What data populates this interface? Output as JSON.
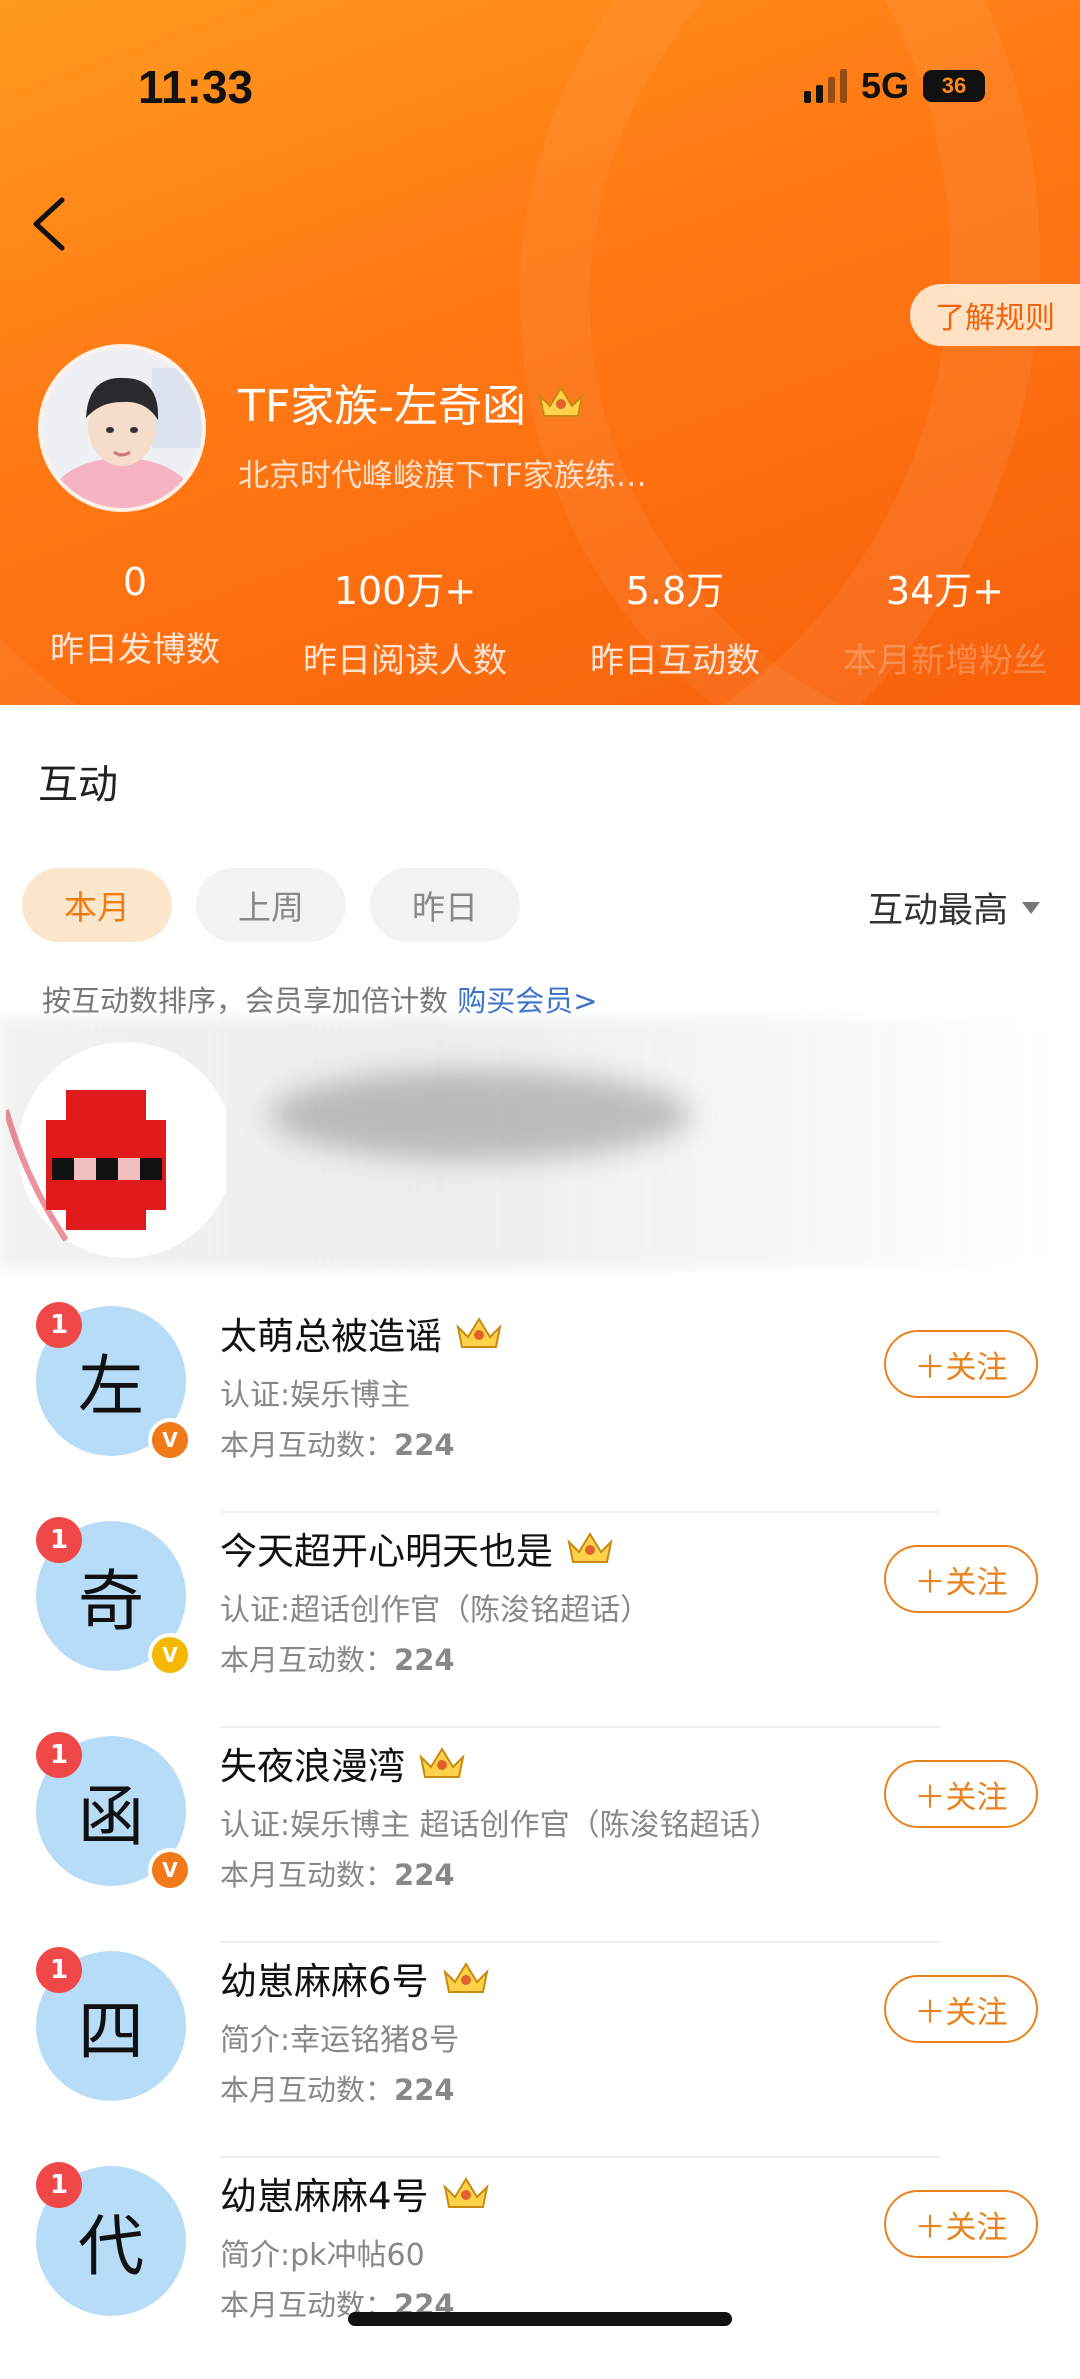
{
  "status": {
    "time": "11:33",
    "network": "5G",
    "battery": "36"
  },
  "header": {
    "rules_label": "了解规则",
    "profile_name": "TF家族-左奇函",
    "profile_desc": "北京时代峰峻旗下TF家族练…",
    "crown_icon": "crown-icon",
    "stats": [
      {
        "value": "0",
        "label": "昨日发博数"
      },
      {
        "value": "100万+",
        "label": "昨日阅读人数"
      },
      {
        "value": "5.8万",
        "label": "昨日互动数"
      },
      {
        "value": "34万+",
        "label": "本月新增粉丝"
      }
    ]
  },
  "section": {
    "title": "互动"
  },
  "tabs": [
    {
      "label": "本月",
      "active": true
    },
    {
      "label": "上周",
      "active": false
    },
    {
      "label": "昨日",
      "active": false
    }
  ],
  "sort": {
    "label": "互动最高"
  },
  "note": {
    "text": "按互动数排序，会员享加倍计数 ",
    "link": "购买会员>"
  },
  "fans": [
    {
      "rank": "1",
      "avatar_char": "左",
      "name": "太萌总被造谣",
      "desc": "认证:娱乐博主",
      "count_label": "本月互动数：",
      "count": "224",
      "verify": "orange",
      "follow": "＋关注"
    },
    {
      "rank": "1",
      "avatar_char": "奇",
      "name": "今天超开心明天也是",
      "desc": "认证:超话创作官（陈浚铭超话）",
      "count_label": "本月互动数：",
      "count": "224",
      "verify": "yellow",
      "follow": "＋关注"
    },
    {
      "rank": "1",
      "avatar_char": "函",
      "name": "失夜浪漫湾",
      "desc": "认证:娱乐博主 超话创作官（陈浚铭超话）",
      "count_label": "本月互动数：",
      "count": "224",
      "verify": "orange",
      "follow": "＋关注"
    },
    {
      "rank": "1",
      "avatar_char": "四",
      "name": "幼崽麻麻6号",
      "desc": "简介:幸运铭猪8号",
      "count_label": "本月互动数：",
      "count": "224",
      "verify": "",
      "follow": "＋关注"
    },
    {
      "rank": "1",
      "avatar_char": "代",
      "name": "幼崽麻麻4号",
      "desc": "简介:pk冲帖60",
      "count_label": "本月互动数：",
      "count": "224",
      "verify": "",
      "follow": "＋关注"
    }
  ],
  "colors": {
    "accent": "#f37a10",
    "header_from": "#ff9a1f",
    "header_to": "#f7600c",
    "verify_orange": "#f07a1a",
    "verify_yellow": "#f5b800",
    "badge_red": "#f04848"
  }
}
